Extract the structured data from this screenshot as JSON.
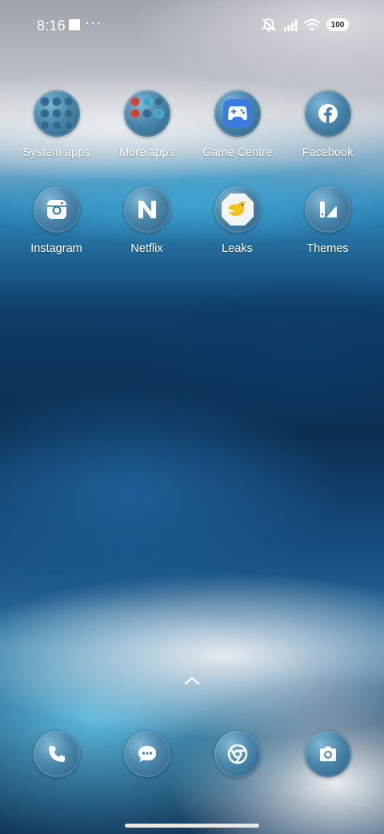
{
  "status": {
    "time": "8:16",
    "more_dots": "···",
    "battery": "100",
    "icons": [
      "gallery-square-icon",
      "mute-icon",
      "signal-icon",
      "wifi-icon",
      "battery-icon"
    ]
  },
  "apps": [
    {
      "label": "System apps",
      "icon": "folder-icon"
    },
    {
      "label": "More apps",
      "icon": "folder-icon"
    },
    {
      "label": "Game Centre",
      "icon": "gamepad-icon"
    },
    {
      "label": "Facebook",
      "icon": "facebook-icon"
    },
    {
      "label": "Instagram",
      "icon": "instagram-icon"
    },
    {
      "label": "Netflix",
      "icon": "netflix-icon"
    },
    {
      "label": "Leaks",
      "icon": "bird-icon"
    },
    {
      "label": "Themes",
      "icon": "themes-icon"
    }
  ],
  "dock": [
    {
      "icon": "phone-icon"
    },
    {
      "icon": "messages-icon"
    },
    {
      "icon": "chrome-icon"
    },
    {
      "icon": "camera-icon"
    }
  ],
  "colors": {
    "icon_bg": "#4a86ab",
    "game_centre_bg": "#3b7ae0",
    "leaks_bg": "#f2f4f6",
    "leaks_bird": "#f2c21a"
  }
}
